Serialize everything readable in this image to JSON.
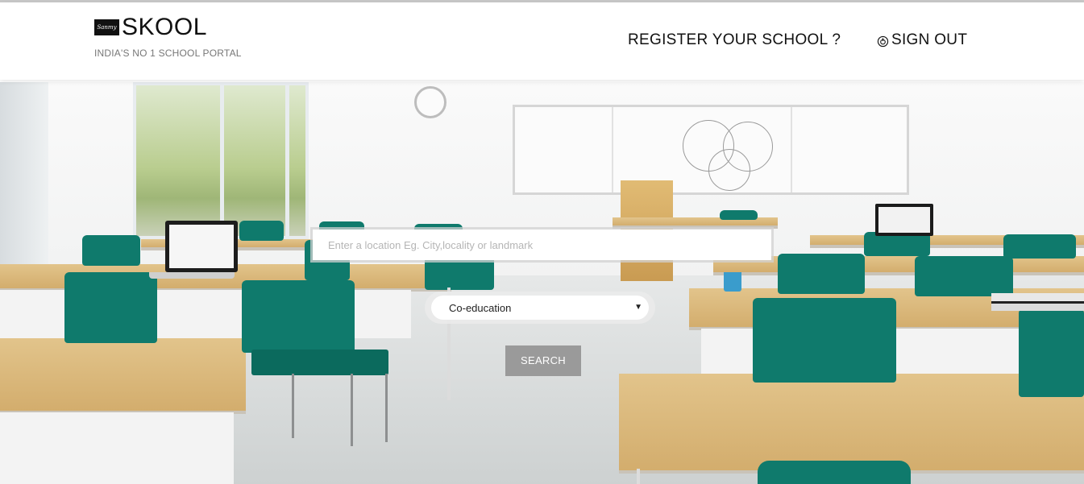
{
  "brand": {
    "logo_badge": "Sanmy",
    "name": "SKOOL",
    "tagline": "INDIA'S NO 1 SCHOOL PORTAL"
  },
  "nav": {
    "register": "REGISTER YOUR SCHOOL ?",
    "sign_out": "SIGN OUT"
  },
  "search": {
    "location_placeholder": "Enter a location Eg. City,locality or landmark",
    "location_value": "",
    "school_type_selected": "Co-education",
    "button_label": "SEARCH"
  },
  "icons": {
    "sign_out_icon": "power-icon",
    "dropdown_icon": "caret-down-icon"
  },
  "colors": {
    "header_bg": "#ffffff",
    "chair_teal": "#0f7a6c",
    "desk_wood": "#d9b77a",
    "search_button_bg": "#9a9a9a"
  }
}
